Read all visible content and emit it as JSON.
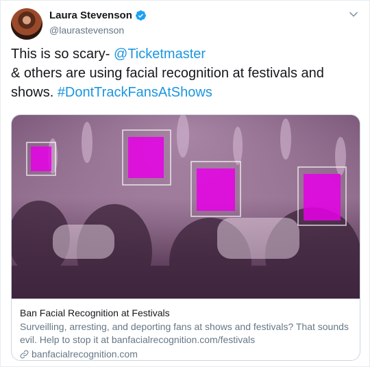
{
  "tweet": {
    "author_name": "Laura Stevenson",
    "author_handle": "@laurastevenson",
    "text_line1_prefix": "This is so scary- ",
    "mention": "@Ticketmaster",
    "text_line2": " & others are using facial recognition at festivals and",
    "text_line3_prefix": "shows. ",
    "hashtag": "#DontTrackFansAtShows"
  },
  "card": {
    "title": "Ban Facial Recognition at Festivals",
    "description": "Surveilling, arresting, and deporting fans at shows and festivals? That sounds evil. Help to stop it at banfacialrecognition.com/festivals",
    "domain": "banfacialrecognition.com"
  },
  "colors": {
    "link": "#1b95e0",
    "face_highlight": "#e600e6",
    "image_tint": "#8a5a86",
    "verified": "#1da1f2"
  },
  "icons": [
    "verified-badge-icon",
    "chevron-down-icon",
    "link-icon"
  ]
}
